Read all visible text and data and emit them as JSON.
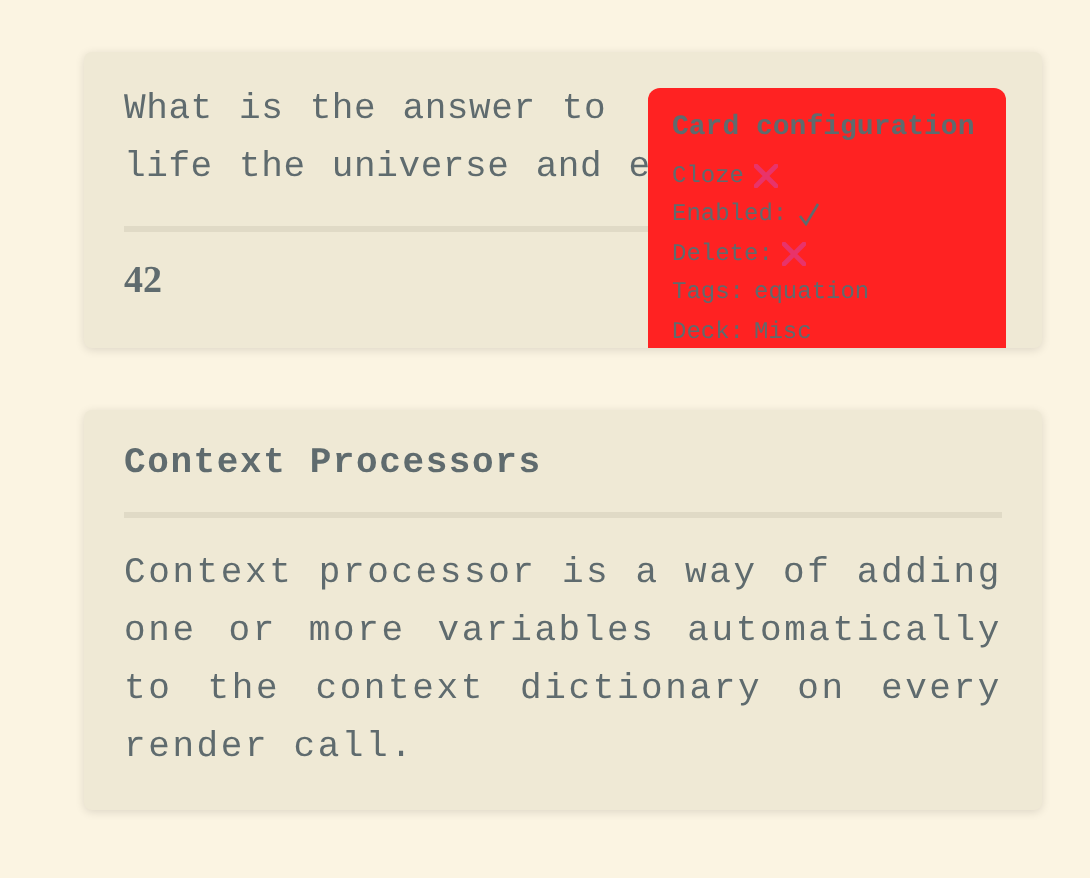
{
  "cards": [
    {
      "question_lines": [
        "What is the answer to",
        "life the universe and e"
      ],
      "answer": "42",
      "config": {
        "title": "Card configuration",
        "items": [
          {
            "label": "Cloze",
            "kind": "flag",
            "on": false
          },
          {
            "label": "Enabled:",
            "kind": "flag",
            "on": true
          },
          {
            "label": "Delete:",
            "kind": "flag",
            "on": false
          },
          {
            "label": "Tags:",
            "kind": "text",
            "value": "equation"
          },
          {
            "label": "Deck:",
            "kind": "text",
            "value": "Misc"
          }
        ]
      }
    },
    {
      "title": "Context Processors",
      "body": "Context processor is a way of adding one or more variables automatically to the context dictionary on every render call."
    }
  ]
}
